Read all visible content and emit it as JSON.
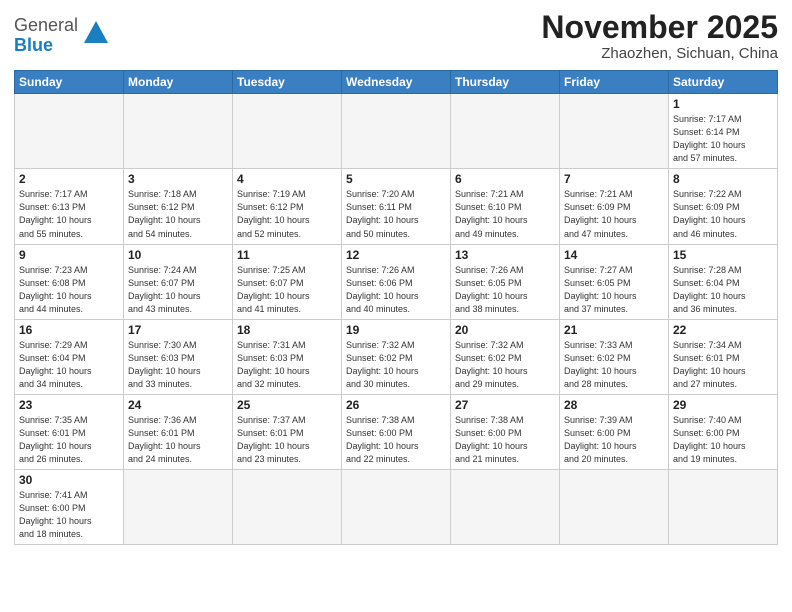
{
  "logo": {
    "general": "General",
    "blue": "Blue"
  },
  "title": "November 2025",
  "location": "Zhaozhen, Sichuan, China",
  "weekdays": [
    "Sunday",
    "Monday",
    "Tuesday",
    "Wednesday",
    "Thursday",
    "Friday",
    "Saturday"
  ],
  "weeks": [
    [
      {
        "day": "",
        "info": ""
      },
      {
        "day": "",
        "info": ""
      },
      {
        "day": "",
        "info": ""
      },
      {
        "day": "",
        "info": ""
      },
      {
        "day": "",
        "info": ""
      },
      {
        "day": "",
        "info": ""
      },
      {
        "day": "1",
        "info": "Sunrise: 7:17 AM\nSunset: 6:14 PM\nDaylight: 10 hours\nand 57 minutes."
      }
    ],
    [
      {
        "day": "2",
        "info": "Sunrise: 7:17 AM\nSunset: 6:13 PM\nDaylight: 10 hours\nand 55 minutes."
      },
      {
        "day": "3",
        "info": "Sunrise: 7:18 AM\nSunset: 6:12 PM\nDaylight: 10 hours\nand 54 minutes."
      },
      {
        "day": "4",
        "info": "Sunrise: 7:19 AM\nSunset: 6:12 PM\nDaylight: 10 hours\nand 52 minutes."
      },
      {
        "day": "5",
        "info": "Sunrise: 7:20 AM\nSunset: 6:11 PM\nDaylight: 10 hours\nand 50 minutes."
      },
      {
        "day": "6",
        "info": "Sunrise: 7:21 AM\nSunset: 6:10 PM\nDaylight: 10 hours\nand 49 minutes."
      },
      {
        "day": "7",
        "info": "Sunrise: 7:21 AM\nSunset: 6:09 PM\nDaylight: 10 hours\nand 47 minutes."
      },
      {
        "day": "8",
        "info": "Sunrise: 7:22 AM\nSunset: 6:09 PM\nDaylight: 10 hours\nand 46 minutes."
      }
    ],
    [
      {
        "day": "9",
        "info": "Sunrise: 7:23 AM\nSunset: 6:08 PM\nDaylight: 10 hours\nand 44 minutes."
      },
      {
        "day": "10",
        "info": "Sunrise: 7:24 AM\nSunset: 6:07 PM\nDaylight: 10 hours\nand 43 minutes."
      },
      {
        "day": "11",
        "info": "Sunrise: 7:25 AM\nSunset: 6:07 PM\nDaylight: 10 hours\nand 41 minutes."
      },
      {
        "day": "12",
        "info": "Sunrise: 7:26 AM\nSunset: 6:06 PM\nDaylight: 10 hours\nand 40 minutes."
      },
      {
        "day": "13",
        "info": "Sunrise: 7:26 AM\nSunset: 6:05 PM\nDaylight: 10 hours\nand 38 minutes."
      },
      {
        "day": "14",
        "info": "Sunrise: 7:27 AM\nSunset: 6:05 PM\nDaylight: 10 hours\nand 37 minutes."
      },
      {
        "day": "15",
        "info": "Sunrise: 7:28 AM\nSunset: 6:04 PM\nDaylight: 10 hours\nand 36 minutes."
      }
    ],
    [
      {
        "day": "16",
        "info": "Sunrise: 7:29 AM\nSunset: 6:04 PM\nDaylight: 10 hours\nand 34 minutes."
      },
      {
        "day": "17",
        "info": "Sunrise: 7:30 AM\nSunset: 6:03 PM\nDaylight: 10 hours\nand 33 minutes."
      },
      {
        "day": "18",
        "info": "Sunrise: 7:31 AM\nSunset: 6:03 PM\nDaylight: 10 hours\nand 32 minutes."
      },
      {
        "day": "19",
        "info": "Sunrise: 7:32 AM\nSunset: 6:02 PM\nDaylight: 10 hours\nand 30 minutes."
      },
      {
        "day": "20",
        "info": "Sunrise: 7:32 AM\nSunset: 6:02 PM\nDaylight: 10 hours\nand 29 minutes."
      },
      {
        "day": "21",
        "info": "Sunrise: 7:33 AM\nSunset: 6:02 PM\nDaylight: 10 hours\nand 28 minutes."
      },
      {
        "day": "22",
        "info": "Sunrise: 7:34 AM\nSunset: 6:01 PM\nDaylight: 10 hours\nand 27 minutes."
      }
    ],
    [
      {
        "day": "23",
        "info": "Sunrise: 7:35 AM\nSunset: 6:01 PM\nDaylight: 10 hours\nand 26 minutes."
      },
      {
        "day": "24",
        "info": "Sunrise: 7:36 AM\nSunset: 6:01 PM\nDaylight: 10 hours\nand 24 minutes."
      },
      {
        "day": "25",
        "info": "Sunrise: 7:37 AM\nSunset: 6:01 PM\nDaylight: 10 hours\nand 23 minutes."
      },
      {
        "day": "26",
        "info": "Sunrise: 7:38 AM\nSunset: 6:00 PM\nDaylight: 10 hours\nand 22 minutes."
      },
      {
        "day": "27",
        "info": "Sunrise: 7:38 AM\nSunset: 6:00 PM\nDaylight: 10 hours\nand 21 minutes."
      },
      {
        "day": "28",
        "info": "Sunrise: 7:39 AM\nSunset: 6:00 PM\nDaylight: 10 hours\nand 20 minutes."
      },
      {
        "day": "29",
        "info": "Sunrise: 7:40 AM\nSunset: 6:00 PM\nDaylight: 10 hours\nand 19 minutes."
      }
    ],
    [
      {
        "day": "30",
        "info": "Sunrise: 7:41 AM\nSunset: 6:00 PM\nDaylight: 10 hours\nand 18 minutes."
      },
      {
        "day": "",
        "info": ""
      },
      {
        "day": "",
        "info": ""
      },
      {
        "day": "",
        "info": ""
      },
      {
        "day": "",
        "info": ""
      },
      {
        "day": "",
        "info": ""
      },
      {
        "day": "",
        "info": ""
      }
    ]
  ]
}
